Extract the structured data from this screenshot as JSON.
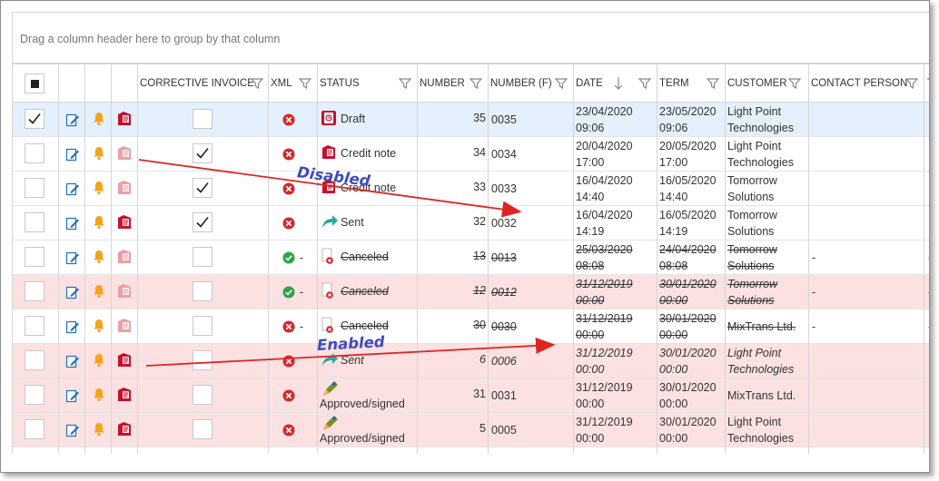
{
  "group_panel": {
    "hint": "Drag a column header here to group by that column"
  },
  "columns": {
    "corrective_invoice": "CORRECTIVE INVOICE",
    "xml": "XML",
    "status": "STATUS",
    "number": "NUMBER",
    "number_f": "NUMBER (F)",
    "date": "DATE",
    "term": "TERM",
    "customer": "CUSTOMER",
    "contact_person": "CONTACT PERSON",
    "next_initial": "T"
  },
  "rows": [
    {
      "selected": true,
      "highlight": false,
      "corrective": false,
      "xml_ok": false,
      "xml_dash": "",
      "status": "Draft",
      "status_icon": "draft-icon",
      "status_style": "normal",
      "number": "35",
      "number_f": "0035",
      "date": [
        "23/04/2020",
        "09:06"
      ],
      "term": [
        "23/05/2020",
        "09:06"
      ],
      "customer": [
        "Light Point",
        "Technologies"
      ],
      "contact": "",
      "invoice_icon_enabled": true
    },
    {
      "selected": false,
      "highlight": false,
      "corrective": true,
      "xml_ok": false,
      "xml_dash": "",
      "status": "Credit note",
      "status_icon": "credit-note-icon",
      "status_style": "normal",
      "number": "34",
      "number_f": "0034",
      "date": [
        "20/04/2020",
        "17:00"
      ],
      "term": [
        "20/05/2020",
        "17:00"
      ],
      "customer": [
        "Light Point",
        "Technologies"
      ],
      "contact": "",
      "invoice_icon_enabled": false
    },
    {
      "selected": false,
      "highlight": false,
      "corrective": true,
      "xml_ok": false,
      "xml_dash": "",
      "status": "Credit note",
      "status_icon": "credit-note-icon",
      "status_style": "normal",
      "number": "33",
      "number_f": "0033",
      "date": [
        "16/04/2020",
        "14:40"
      ],
      "term": [
        "16/05/2020",
        "14:40"
      ],
      "customer": [
        "Tomorrow",
        "Solutions"
      ],
      "contact": "",
      "invoice_icon_enabled": false
    },
    {
      "selected": false,
      "highlight": false,
      "corrective": true,
      "xml_ok": false,
      "xml_dash": "",
      "status": "Sent",
      "status_icon": "sent-arrow-icon",
      "status_style": "normal",
      "number": "32",
      "number_f": "0032",
      "date": [
        "16/04/2020",
        "14:19"
      ],
      "term": [
        "16/05/2020",
        "14:19"
      ],
      "customer": [
        "Tomorrow",
        "Solutions"
      ],
      "contact": "",
      "invoice_icon_enabled": true
    },
    {
      "selected": false,
      "highlight": false,
      "corrective": false,
      "xml_ok": true,
      "xml_dash": "-",
      "status": "Canceled",
      "status_icon": "canceled-icon",
      "status_style": "strike",
      "number": "13",
      "number_f": "0013",
      "date": [
        "25/03/2020",
        "08:08"
      ],
      "term": [
        "24/04/2020",
        "08:08"
      ],
      "customer": [
        "Tomorrow",
        "Solutions"
      ],
      "contact": "-",
      "invoice_icon_enabled": false
    },
    {
      "selected": false,
      "highlight": true,
      "corrective": false,
      "xml_ok": true,
      "xml_dash": "-",
      "status": "Canceled",
      "status_icon": "canceled-icon",
      "status_style": "strike-italic",
      "number": "12",
      "number_f": "0012",
      "date": [
        "31/12/2019",
        "00:00"
      ],
      "term": [
        "30/01/2020",
        "00:00"
      ],
      "customer": [
        "Tomorrow",
        "Solutions"
      ],
      "contact": "-",
      "invoice_icon_enabled": false
    },
    {
      "selected": false,
      "highlight": false,
      "corrective": false,
      "xml_ok": false,
      "xml_dash": "-",
      "status": "Canceled",
      "status_icon": "canceled-icon",
      "status_style": "strike",
      "number": "30",
      "number_f": "0030",
      "date": [
        "31/12/2019",
        "00:00"
      ],
      "term": [
        "30/01/2020",
        "00:00"
      ],
      "customer": [
        "MixTrans Ltd.",
        ""
      ],
      "contact": "-",
      "invoice_icon_enabled": false
    },
    {
      "selected": false,
      "highlight": true,
      "corrective": false,
      "xml_ok": false,
      "xml_dash": "",
      "status": "Sent",
      "status_icon": "sent-arrow-icon",
      "status_style": "italic",
      "number": "6",
      "number_f": "0006",
      "date": [
        "31/12/2019",
        "00:00"
      ],
      "term": [
        "30/01/2020",
        "00:00"
      ],
      "customer": [
        "Light Point",
        "Technologies"
      ],
      "contact": "",
      "invoice_icon_enabled": true
    },
    {
      "selected": false,
      "highlight": true,
      "corrective": false,
      "xml_ok": false,
      "xml_dash": "",
      "status": "Approved/signed",
      "status_icon": "approved-pen-icon",
      "status_style": "normal",
      "number": "31",
      "number_f": "0031",
      "date": [
        "31/12/2019",
        "00:00"
      ],
      "term": [
        "30/01/2020",
        "00:00"
      ],
      "customer": [
        "MixTrans Ltd.",
        ""
      ],
      "contact": "",
      "invoice_icon_enabled": true
    },
    {
      "selected": false,
      "highlight": true,
      "corrective": false,
      "xml_ok": false,
      "xml_dash": "",
      "status": "Approved/signed",
      "status_icon": "approved-pen-icon",
      "status_style": "normal",
      "number": "5",
      "number_f": "0005",
      "date": [
        "31/12/2019",
        "00:00"
      ],
      "term": [
        "30/01/2020",
        "00:00"
      ],
      "customer": [
        "Light Point",
        "Technologies"
      ],
      "contact": "",
      "invoice_icon_enabled": true
    }
  ],
  "annotations": {
    "disabled": "Disabled",
    "enabled": "Enabled",
    "arrow_color": "#e02424"
  },
  "colors": {
    "selected_row": "#e4f0fb",
    "highlight_row": "#fbe1e1",
    "icon_blue": "#1f6fc4",
    "bell": "#f5a31a",
    "error_red": "#d9262a",
    "ok_green": "#28a745"
  }
}
